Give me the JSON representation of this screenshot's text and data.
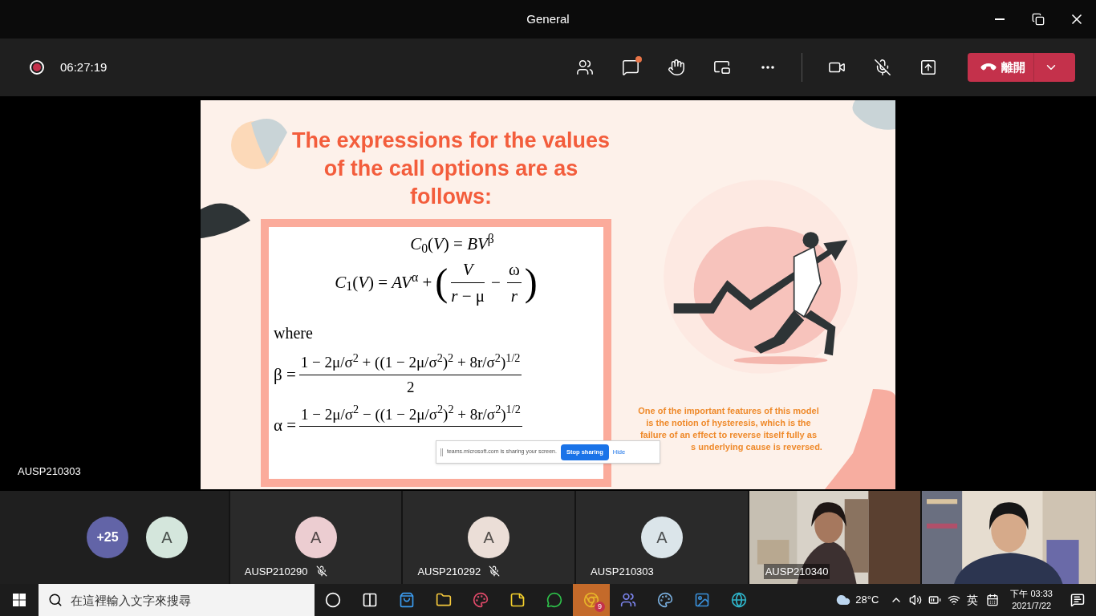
{
  "window": {
    "title": "General"
  },
  "meeting_bar": {
    "recording": true,
    "timer": "06:27:19",
    "controls": [
      {
        "kind": "people",
        "notification": false
      },
      {
        "kind": "chat",
        "notification": true
      },
      {
        "kind": "reactions",
        "notification": false
      },
      {
        "kind": "layout",
        "notification": false
      },
      {
        "kind": "more",
        "notification": false
      },
      {
        "kind": "camera",
        "notification": false
      },
      {
        "kind": "mic-off",
        "notification": false
      },
      {
        "kind": "share",
        "notification": false
      }
    ],
    "leave_button": {
      "label": "離開"
    }
  },
  "stage": {
    "presenter": "AUSP210303",
    "slide": {
      "title": "The expressions for the values of the call options are as follows:",
      "equations": [
        {
          "kind": "line",
          "text": "*C*$_{0}$(*V*) = *BV*$^{β}$"
        },
        {
          "kind": "expression",
          "lhs": "*C*$_{1}$(*V*) = *AV*$^{α}$ +",
          "open": "(",
          "terms": [
            {
              "numerator": "*V*",
              "denominator": "*r* − μ"
            },
            {
              "operator": "−",
              "numerator": "ω",
              "denominator": "*r*"
            }
          ],
          "close": ")"
        },
        {
          "kind": "text",
          "text": "where"
        },
        {
          "kind": "fraction",
          "lhs": "β =",
          "numerator": "1 − 2μ/σ$^{2}$ + ((1 − 2μ/σ$^{2}$)$^{2}$ + 8r/σ$^{2}$)$^{1/2}$",
          "denominator": "2"
        },
        {
          "kind": "fraction",
          "lhs": "α =",
          "numerator": "1 − 2μ/σ$^{2}$ − ((1 − 2μ/σ$^{2}$)$^{2}$ + 8r/σ$^{2}$)$^{1/2}$"
        }
      ],
      "note_lines": [
        "One of the important features of this model",
        "is the notion of hysteresis, which is the",
        "failure of an effect to reverse itself fully as",
        "s underlying cause is reversed."
      ]
    },
    "sharing_bar": {
      "message": "teams.microsoft.com is sharing your screen.",
      "stop_button": "Stop sharing",
      "hide_button": "Hide"
    }
  },
  "participants": {
    "overflow": "+25",
    "roster": [
      {
        "initial": "A",
        "color": "#d4e6dc"
      }
    ],
    "tiles": [
      {
        "kind": "avatar",
        "name": "AUSP210290",
        "initial": "A",
        "color": "#eccdd1",
        "muted": true
      },
      {
        "kind": "avatar",
        "name": "AUSP210292",
        "initial": "A",
        "color": "#ebded7",
        "muted": true
      },
      {
        "kind": "avatar",
        "name": "AUSP210303",
        "initial": "A",
        "color": "#dbe5ea",
        "muted": false
      },
      {
        "kind": "video",
        "name": "AUSP210340",
        "muted": false
      },
      {
        "kind": "video"
      }
    ]
  },
  "taskbar": {
    "search_placeholder": "在這裡輸入文字來搜尋",
    "apps": [
      {
        "active": false
      },
      {
        "active": false
      },
      {
        "active": false
      },
      {
        "active": false
      },
      {
        "active": false
      },
      {
        "active": false
      },
      {
        "active": false
      },
      {
        "active": true,
        "badge": "9"
      },
      {
        "active": false
      },
      {
        "active": false
      },
      {
        "active": false
      },
      {
        "active": false
      }
    ],
    "weather": "28°C",
    "input_method": "英",
    "time": "下午 03:33",
    "date": "2021/7/22"
  }
}
